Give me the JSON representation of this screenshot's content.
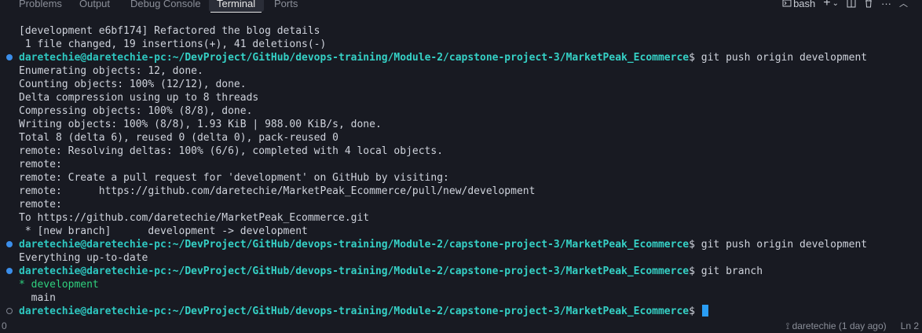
{
  "panel_tabs": [
    "Problems",
    "Output",
    "Debug Console",
    "Terminal",
    "Ports"
  ],
  "active_tab": "Terminal",
  "toolbar": {
    "shell_label": "bash",
    "icons": [
      "terminal-icon",
      "add-icon",
      "chevron-down-icon",
      "split-icon",
      "trash-icon",
      "more-icon",
      "chevron-up-icon"
    ]
  },
  "terminal": {
    "prompt_user": "daretechie@daretechie-pc",
    "prompt_path": ":~/DevProject/GitHub/devops-training/Module-2/capstone-project-3/MarketPeak_Ecommerce",
    "lines": [
      {
        "type": "out",
        "text": "[development e6bf174] Refactored the blog details"
      },
      {
        "type": "out",
        "text": " 1 file changed, 19 insertions(+), 41 deletions(-)"
      },
      {
        "type": "cmd",
        "dot": "filled",
        "cmd": "$ git push origin development"
      },
      {
        "type": "out",
        "text": "Enumerating objects: 12, done."
      },
      {
        "type": "out",
        "text": "Counting objects: 100% (12/12), done."
      },
      {
        "type": "out",
        "text": "Delta compression using up to 8 threads"
      },
      {
        "type": "out",
        "text": "Compressing objects: 100% (8/8), done."
      },
      {
        "type": "out",
        "text": "Writing objects: 100% (8/8), 1.93 KiB | 988.00 KiB/s, done."
      },
      {
        "type": "out",
        "text": "Total 8 (delta 6), reused 0 (delta 0), pack-reused 0"
      },
      {
        "type": "out",
        "text": "remote: Resolving deltas: 100% (6/6), completed with 4 local objects."
      },
      {
        "type": "out",
        "text": "remote:"
      },
      {
        "type": "out",
        "text": "remote: Create a pull request for 'development' on GitHub by visiting:"
      },
      {
        "type": "out",
        "text": "remote:      https://github.com/daretechie/MarketPeak_Ecommerce/pull/new/development"
      },
      {
        "type": "out",
        "text": "remote:"
      },
      {
        "type": "out",
        "text": "To https://github.com/daretechie/MarketPeak_Ecommerce.git"
      },
      {
        "type": "out",
        "text": " * [new branch]      development -> development"
      },
      {
        "type": "cmd",
        "dot": "filled",
        "cmd": "$ git push origin development"
      },
      {
        "type": "out",
        "text": "Everything up-to-date"
      },
      {
        "type": "cmd",
        "dot": "filled",
        "cmd": "$ git branch"
      },
      {
        "type": "branch",
        "text": "* development"
      },
      {
        "type": "out",
        "text": "  main"
      },
      {
        "type": "cmd",
        "dot": "empty",
        "cmd": "$ ",
        "cursor": true
      }
    ]
  },
  "status_bar": {
    "left": "0",
    "blame": "daretechie (1 day ago)",
    "position": "Ln 2"
  }
}
